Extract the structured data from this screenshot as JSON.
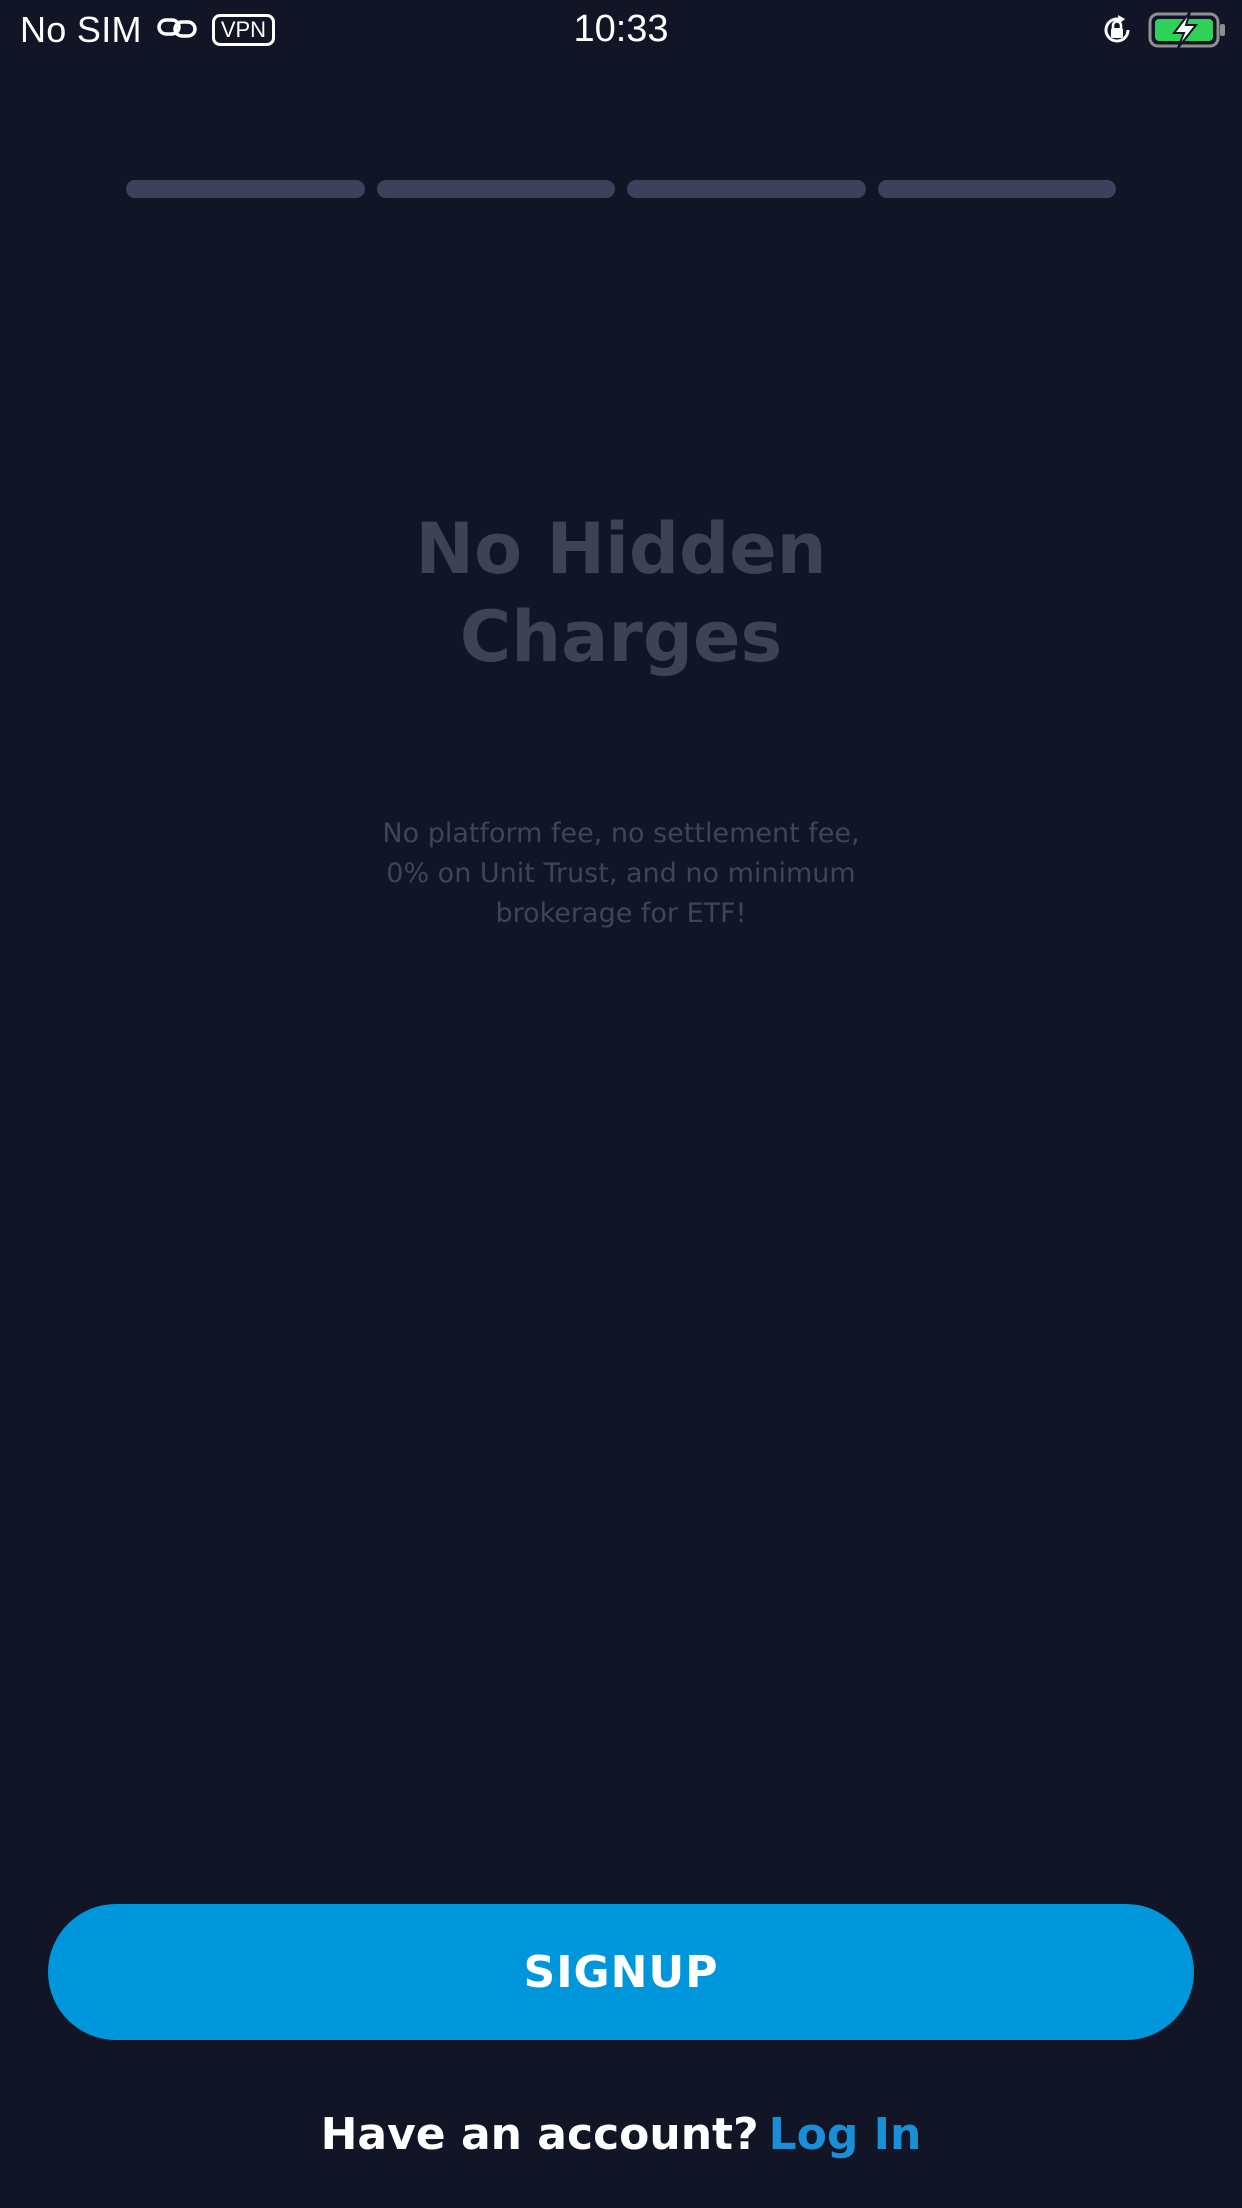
{
  "status_bar": {
    "carrier": "No SIM",
    "vpn_label": "VPN",
    "time": "10:33",
    "icons": [
      "link-icon",
      "orientation-lock-icon",
      "battery-charging-icon"
    ],
    "battery_color": "#30d158"
  },
  "onboarding": {
    "progress_segments": 4,
    "title": "No Hidden\nCharges",
    "description": "No platform fee, no settlement fee, 0% on Unit Trust, and no minimum brokerage for ETF!"
  },
  "actions": {
    "signup_label": "SIGNUP",
    "login_prompt": "Have an account?",
    "login_link": "Log In"
  },
  "colors": {
    "background": "#111526",
    "primary": "#0096db",
    "link": "#1a8fd8"
  }
}
